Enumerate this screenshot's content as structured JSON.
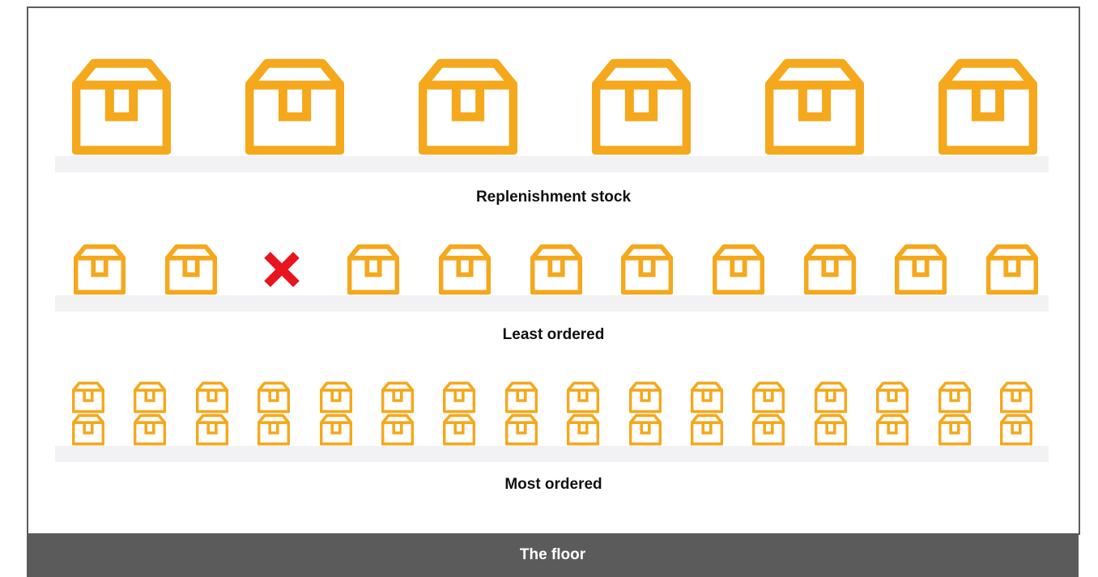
{
  "colors": {
    "box": "#F5A81C",
    "shelf": "#F2F2F4",
    "frame": "#5C5C5C",
    "floor": "#5B5B5B",
    "missing_marker": "#E8141E"
  },
  "icons": {
    "box": "package-box-icon",
    "missing": "red-x-icon"
  },
  "shelves": [
    {
      "label": "Replenishment stock",
      "box_count": 6,
      "stack_height": 1,
      "missing_positions": []
    },
    {
      "label": "Least ordered",
      "box_count": 11,
      "stack_height": 1,
      "missing_positions": [
        3
      ]
    },
    {
      "label": "Most ordered",
      "box_count": 16,
      "stack_height": 2,
      "missing_positions": []
    }
  ],
  "floor": {
    "label": "The floor"
  }
}
